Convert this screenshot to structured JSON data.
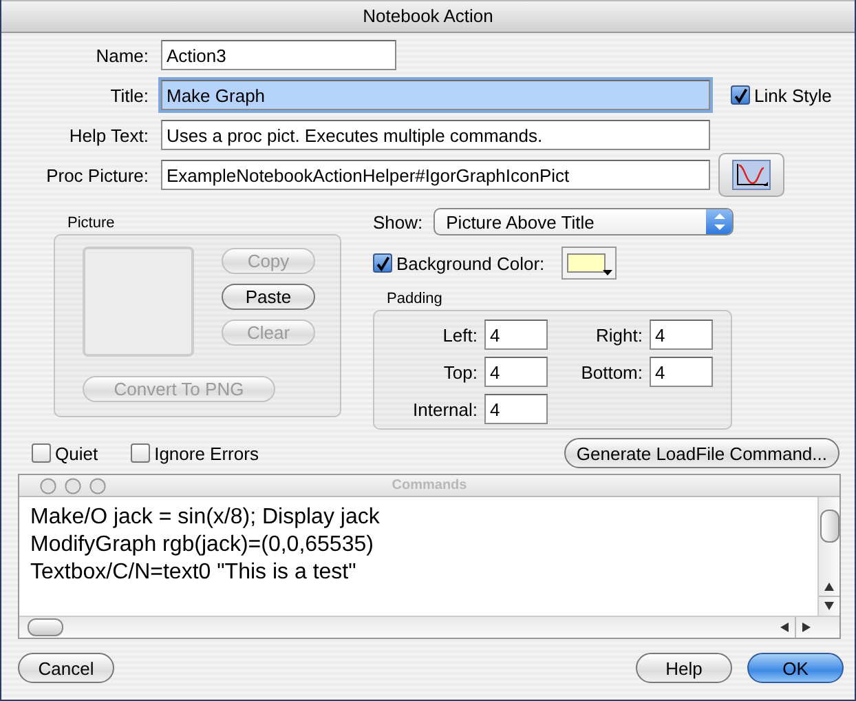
{
  "window": {
    "title": "Notebook Action"
  },
  "fields": [
    {
      "label": "Name:",
      "value": "Action3",
      "kind": "short",
      "focused": false
    },
    {
      "label": "Title:",
      "value": "Make Graph",
      "kind": "link",
      "focused": true
    },
    {
      "label": "Help Text:",
      "value": "Uses a proc pict. Executes multiple commands.",
      "kind": "long",
      "focused": false
    },
    {
      "label": "Proc Picture:",
      "value": "ExampleNotebookActionHelper#IgorGraphIconPict",
      "kind": "picture",
      "focused": false
    }
  ],
  "link_style": {
    "label": "Link Style",
    "checked": true
  },
  "picture_group": {
    "title": "Picture",
    "buttons": [
      {
        "label": "Copy",
        "disabled": true
      },
      {
        "label": "Paste",
        "disabled": false
      },
      {
        "label": "Clear",
        "disabled": true
      }
    ],
    "convert_button": {
      "label": "Convert To PNG",
      "disabled": true
    }
  },
  "show": {
    "label": "Show:",
    "value": "Picture Above Title"
  },
  "background_color": {
    "label": "Background Color:",
    "checked": true,
    "color": "#ffffc0"
  },
  "padding": {
    "title": "Padding",
    "fields": [
      {
        "label": "Left:",
        "value": "4"
      },
      {
        "label": "Right:",
        "value": "4"
      },
      {
        "label": "Top:",
        "value": "4"
      },
      {
        "label": "Bottom:",
        "value": "4"
      },
      {
        "label": "Internal:",
        "value": "4"
      }
    ]
  },
  "options": [
    {
      "label": "Quiet",
      "checked": false
    },
    {
      "label": "Ignore Errors",
      "checked": false
    }
  ],
  "generate_button": "Generate LoadFile Command...",
  "commands": {
    "title": "Commands",
    "lines": [
      "Make/O jack = sin(x/8); Display jack",
      "ModifyGraph rgb(jack)=(0,0,65535)",
      "Textbox/C/N=text0 \"This is a test\""
    ]
  },
  "buttons": [
    {
      "label": "Cancel",
      "default": false
    },
    {
      "label": "Help",
      "default": false
    },
    {
      "label": "OK",
      "default": true
    }
  ]
}
